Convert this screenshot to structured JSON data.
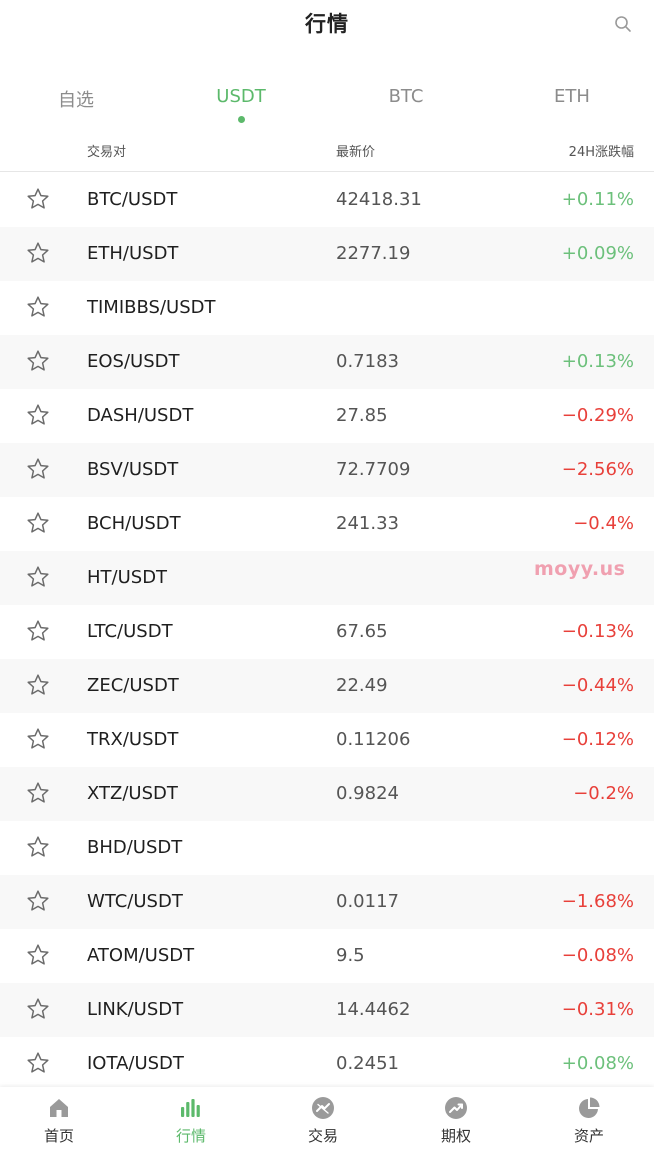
{
  "header": {
    "title": "行情",
    "search_icon": "search-icon"
  },
  "tabs": [
    {
      "label": "自选",
      "active": false
    },
    {
      "label": "USDT",
      "active": true
    },
    {
      "label": "BTC",
      "active": false
    },
    {
      "label": "ETH",
      "active": false
    }
  ],
  "columns": {
    "pair": "交易对",
    "price": "最新价",
    "change": "24H涨跌幅"
  },
  "rows": [
    {
      "pair": "BTC/USDT",
      "price": "42418.31",
      "change": "+0.11%",
      "dir": "up"
    },
    {
      "pair": "ETH/USDT",
      "price": "2277.19",
      "change": "+0.09%",
      "dir": "up"
    },
    {
      "pair": "TIMIBBS/USDT",
      "price": "",
      "change": "",
      "dir": ""
    },
    {
      "pair": "EOS/USDT",
      "price": "0.7183",
      "change": "+0.13%",
      "dir": "up"
    },
    {
      "pair": "DASH/USDT",
      "price": "27.85",
      "change": "−0.29%",
      "dir": "down"
    },
    {
      "pair": "BSV/USDT",
      "price": "72.7709",
      "change": "−2.56%",
      "dir": "down"
    },
    {
      "pair": "BCH/USDT",
      "price": "241.33",
      "change": "−0.4%",
      "dir": "down"
    },
    {
      "pair": "HT/USDT",
      "price": "",
      "change": "",
      "dir": ""
    },
    {
      "pair": "LTC/USDT",
      "price": "67.65",
      "change": "−0.13%",
      "dir": "down"
    },
    {
      "pair": "ZEC/USDT",
      "price": "22.49",
      "change": "−0.44%",
      "dir": "down"
    },
    {
      "pair": "TRX/USDT",
      "price": "0.11206",
      "change": "−0.12%",
      "dir": "down"
    },
    {
      "pair": "XTZ/USDT",
      "price": "0.9824",
      "change": "−0.2%",
      "dir": "down"
    },
    {
      "pair": "BHD/USDT",
      "price": "",
      "change": "",
      "dir": ""
    },
    {
      "pair": "WTC/USDT",
      "price": "0.0117",
      "change": "−1.68%",
      "dir": "down"
    },
    {
      "pair": "ATOM/USDT",
      "price": "9.5",
      "change": "−0.08%",
      "dir": "down"
    },
    {
      "pair": "LINK/USDT",
      "price": "14.4462",
      "change": "−0.31%",
      "dir": "down"
    },
    {
      "pair": "IOTA/USDT",
      "price": "0.2451",
      "change": "+0.08%",
      "dir": "up"
    }
  ],
  "watermark": "moyy.us",
  "nav": [
    {
      "label": "首页",
      "icon": "home-icon",
      "active": false
    },
    {
      "label": "行情",
      "icon": "bar-chart-icon",
      "active": true
    },
    {
      "label": "交易",
      "icon": "exchange-icon",
      "active": false
    },
    {
      "label": "期权",
      "icon": "trend-up-icon",
      "active": false
    },
    {
      "label": "资产",
      "icon": "pie-chart-icon",
      "active": false
    }
  ],
  "colors": {
    "accent": "#5cb96b",
    "up": "#6cc07b",
    "down": "#e8403a",
    "icon_gray": "#9a9a9a"
  }
}
